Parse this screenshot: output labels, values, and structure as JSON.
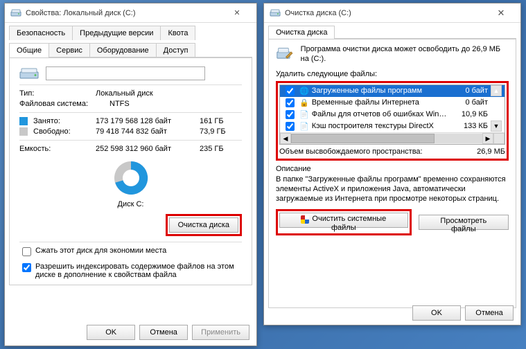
{
  "left": {
    "title": "Свойства: Локальный диск (C:)",
    "tabs_top": [
      "Безопасность",
      "Предыдущие версии",
      "Квота"
    ],
    "tabs_bottom": [
      "Общие",
      "Сервис",
      "Оборудование",
      "Доступ"
    ],
    "type_label": "Тип:",
    "type_value": "Локальный диск",
    "fs_label": "Файловая система:",
    "fs_value": "NTFS",
    "used_label": "Занято:",
    "used_bytes": "173 179 568 128 байт",
    "used_gb": "161 ГБ",
    "free_label": "Свободно:",
    "free_bytes": "79 418 744 832 байт",
    "free_gb": "73,9 ГБ",
    "cap_label": "Емкость:",
    "cap_bytes": "252 598 312 960 байт",
    "cap_gb": "235 ГБ",
    "disk_label": "Диск C:",
    "cleanup_btn": "Очистка диска",
    "compress_label": "Сжать этот диск для экономии места",
    "compress_checked": false,
    "index_label": "Разрешить индексировать содержимое файлов на этом диске в дополнение к свойствам файла",
    "index_checked": true,
    "ok": "OK",
    "cancel": "Отмена",
    "apply": "Применить"
  },
  "right": {
    "title": "Очистка диска  (C:)",
    "tab": "Очистка диска",
    "msg": "Программа очистки диска может освободить до 26,9 МБ на  (C:).",
    "delete_label": "Удалить следующие файлы:",
    "files": [
      {
        "name": "Загруженные файлы программ",
        "size": "0 байт",
        "icon": "globe",
        "sel": true
      },
      {
        "name": "Временные файлы Интернета",
        "size": "0 байт",
        "icon": "lock",
        "sel": false
      },
      {
        "name": "Файлы для отчетов об ошибках Win…",
        "size": "10,9 КБ",
        "icon": "file",
        "sel": false
      },
      {
        "name": "Кэш построителя текстуры DirectX",
        "size": "133 КБ",
        "icon": "file",
        "sel": false
      }
    ],
    "freed_label": "Объем высвобождаемого пространства:",
    "freed_value": "26,9 МБ",
    "desc_label": "Описание",
    "desc_text": "В папке \"Загруженные файлы программ\" временно сохраняются элементы ActiveX и приложения Java, автоматически загружаемые из Интернета при просмотре некоторых страниц.",
    "sys_btn": "Очистить системные файлы",
    "view_btn": "Просмотреть файлы",
    "ok": "OK",
    "cancel": "Отмена"
  },
  "chart_data": {
    "type": "pie",
    "title": "Диск C:",
    "series": [
      {
        "name": "Занято",
        "value": 173179568128,
        "display": "161 ГБ",
        "color": "#2196dd"
      },
      {
        "name": "Свободно",
        "value": 79418744832,
        "display": "73,9 ГБ",
        "color": "#c8c8c8"
      }
    ],
    "total": {
      "name": "Емкость",
      "value": 252598312960,
      "display": "235 ГБ"
    }
  }
}
